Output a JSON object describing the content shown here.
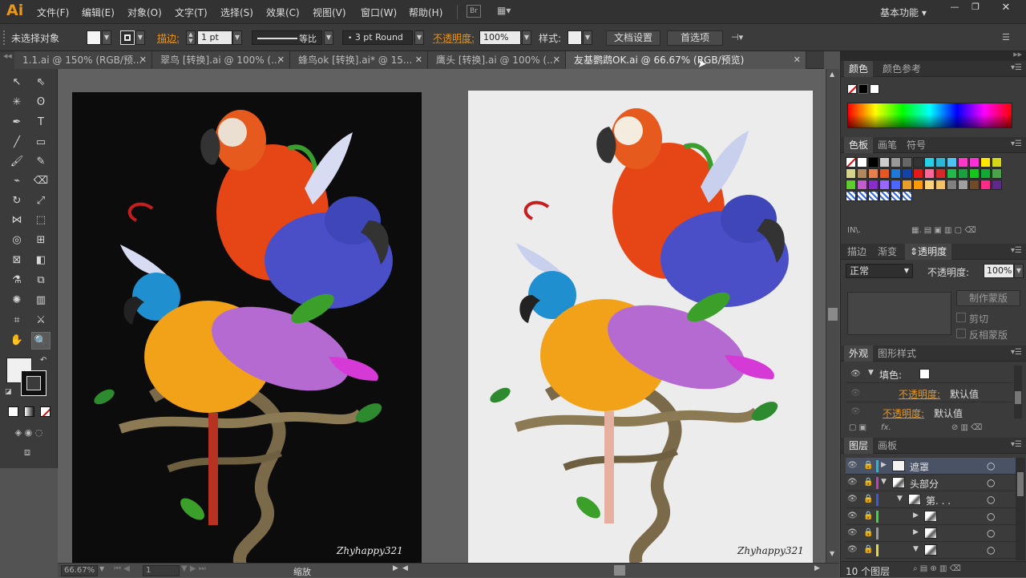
{
  "app": {
    "logo": "Ai"
  },
  "menu": [
    "文件(F)",
    "编辑(E)",
    "对象(O)",
    "文字(T)",
    "选择(S)",
    "效果(C)",
    "视图(V)",
    "窗口(W)",
    "帮助(H)"
  ],
  "menu_extra": {
    "bridge": "Br",
    "workspace": "基本功能"
  },
  "control": {
    "selection": "未选择对象",
    "stroke_label": "描边:",
    "stroke_weight": "1 pt",
    "stroke_profile": "等比",
    "brush": "3 pt Round",
    "opacity_label": "不透明度:",
    "opacity_value": "100%",
    "style_label": "样式:",
    "doc_setup": "文档设置",
    "prefs": "首选项"
  },
  "tabs": [
    {
      "label": "1.1.ai @ 150% (RGB/预...",
      "active": false
    },
    {
      "label": "翠鸟 [转换].ai @ 100% (...",
      "active": false
    },
    {
      "label": "蜂鸟ok [转换].ai* @ 15...",
      "active": false
    },
    {
      "label": "鹰头 [转换].ai @ 100% (...",
      "active": false
    },
    {
      "label": "友基鹦鹉OK.ai @ 66.67% (RGB/预览)",
      "active": true
    }
  ],
  "canvas": {
    "signature": "Zhyhappy321"
  },
  "status": {
    "zoom": "66.67%",
    "page": "1",
    "tool": "缩放"
  },
  "color_panel": {
    "tabs": [
      "颜色",
      "颜色参考"
    ]
  },
  "swatch_panel": {
    "tabs": [
      "色板",
      "画笔",
      "符号"
    ]
  },
  "transparency_panel": {
    "tabs": [
      "描边",
      "渐变",
      "透明度"
    ],
    "blend_mode": "正常",
    "opacity_label": "不透明度:",
    "opacity_value": "100%",
    "make_mask": "制作蒙版",
    "clip": "剪切",
    "invert_mask": "反相蒙版"
  },
  "appearance_panel": {
    "tabs": [
      "外观",
      "图形样式"
    ],
    "fill_label": "填色:",
    "rows": [
      {
        "label": "不透明度:",
        "value": "默认值"
      },
      {
        "label": "不透明度:",
        "value": "默认值"
      }
    ]
  },
  "layers_panel": {
    "tabs": [
      "图层",
      "画板"
    ],
    "layers": [
      {
        "name": "遮罩",
        "color": "#26b7d6",
        "level": 0,
        "expanded": false
      },
      {
        "name": "头部分",
        "color": "#c040c0",
        "level": 0,
        "expanded": true
      },
      {
        "name": "第. . .",
        "color": "#3a5bd6",
        "level": 1,
        "expanded": true
      },
      {
        "name": "",
        "color": "#3ad63a",
        "level": 2,
        "expanded": false
      },
      {
        "name": "",
        "color": "#9a9a9a",
        "level": 2,
        "expanded": false
      },
      {
        "name": "",
        "color": "#e6d83a",
        "level": 2,
        "expanded": true
      }
    ],
    "count": "10 个图层"
  },
  "colors": {
    "accent": "#e8961e",
    "swatches": [
      "#ffffff",
      "#000000",
      "#cccccc",
      "#999999",
      "#666666",
      "#333333",
      "#25d1e8",
      "#2ab8d6",
      "#4cc3f0",
      "#ff38c8",
      "#ff2fd8",
      "#ffe700",
      "#d6d619",
      "#d4d48a",
      "#b08a5e",
      "#e6804d",
      "#e65722",
      "#1f7ad6",
      "#1543a8",
      "#e61919",
      "#ff6699",
      "#d62a2a",
      "#23b84c",
      "#1aa03e",
      "#16c71b",
      "#11a833",
      "#49a349",
      "#5fcc2e",
      "#c25ecc",
      "#8a2bcc",
      "#9966ff",
      "#4d66ff",
      "#e8a02a",
      "#ff9900",
      "#ffd27a",
      "#f2c166",
      "#808080",
      "#a0a0a0",
      "#6f4b2a",
      "#ff2a8a",
      "#5d2a8a",
      "#1f4a9a"
    ]
  }
}
